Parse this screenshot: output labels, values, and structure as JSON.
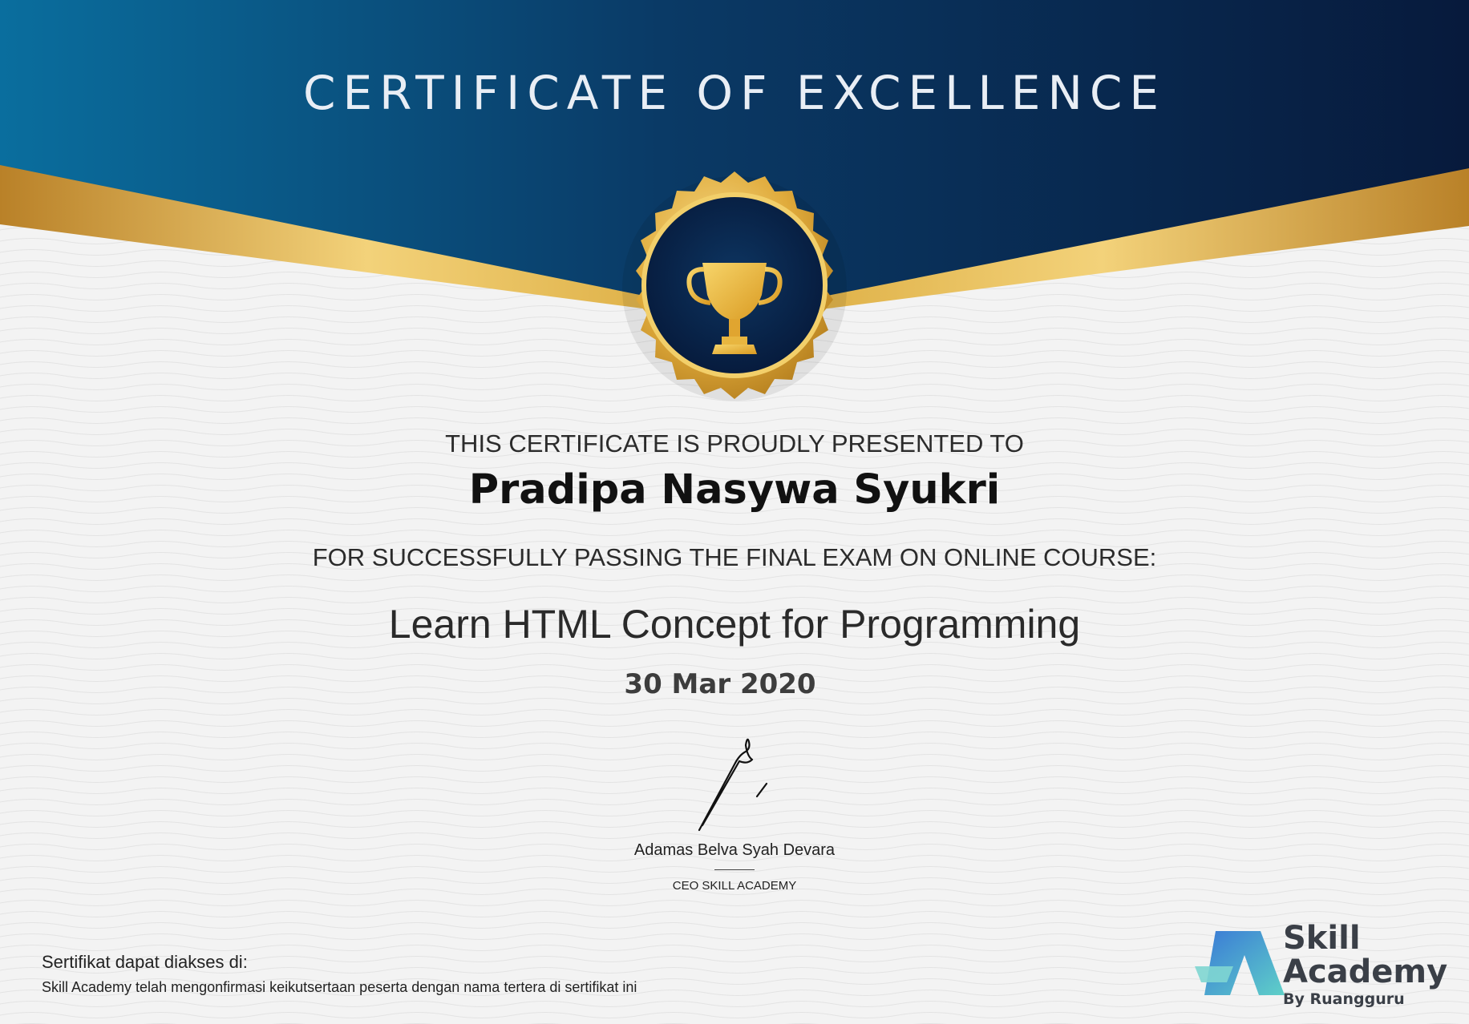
{
  "certificate": {
    "title": "CERTIFICATE OF EXCELLENCE",
    "presented_to": "THIS CERTIFICATE IS PROUDLY PRESENTED TO",
    "recipient_name": "Pradipa Nasywa Syukri",
    "reason": "FOR SUCCESSFULLY PASSING THE FINAL EXAM ON ONLINE COURSE:",
    "course_name": "Learn HTML Concept for Programming",
    "date": "30 Mar 2020",
    "signer_name": "Adamas Belva Syah Devara",
    "signer_role": "CEO SKILL ACADEMY"
  },
  "footer": {
    "access_title": "Sertifikat dapat diakses di:",
    "access_note": "Skill Academy telah mengonfirmasi keikutsertaan peserta dengan nama tertera di sertifikat ini"
  },
  "logo": {
    "line1": "Skill",
    "line2": "Academy",
    "tagline": "By Ruangguru"
  },
  "colors": {
    "navy": "#0a2a50",
    "teal": "#0a6e9e",
    "gold": "#d9a83a",
    "background": "#f3f3f3"
  },
  "icons": {
    "medal": "trophy-medal-icon",
    "signature": "handwritten-signature",
    "logo_mark": "skill-academy-logo-mark"
  }
}
